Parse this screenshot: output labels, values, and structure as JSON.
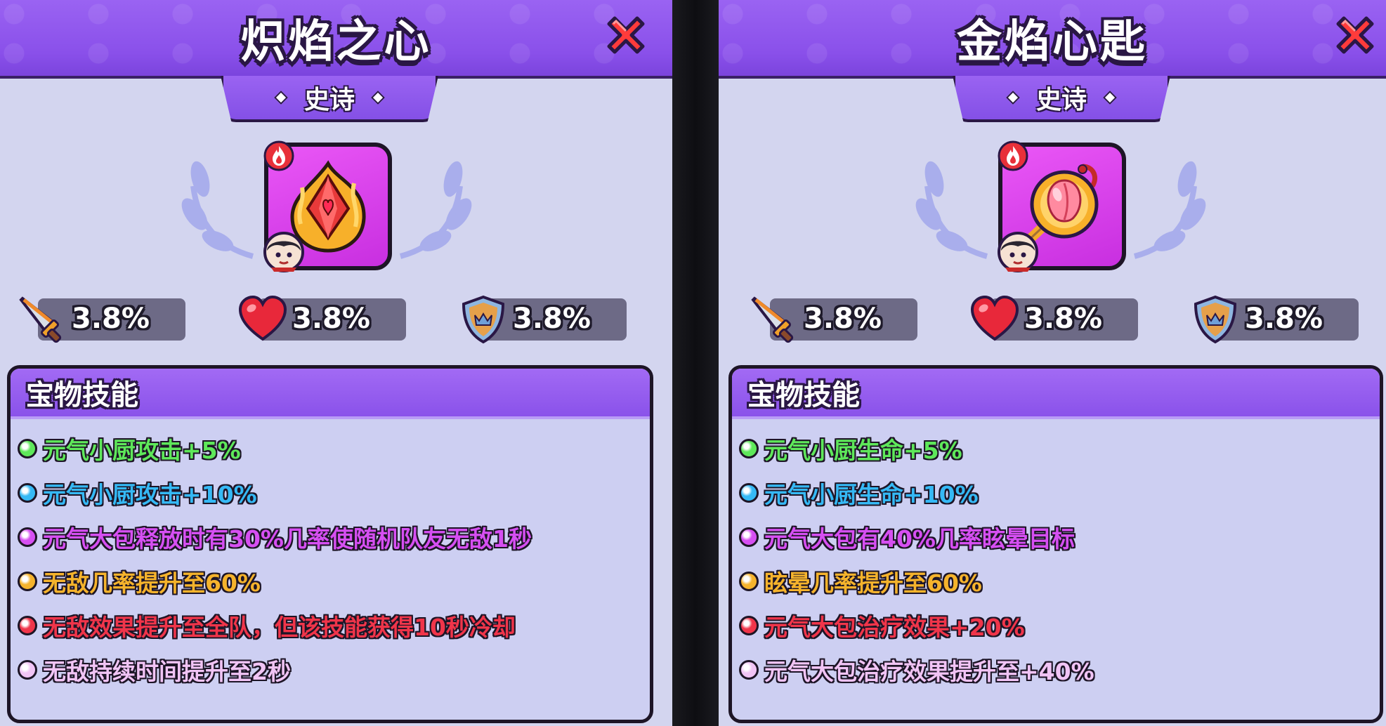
{
  "colors": {
    "tier1_green": "#5ee85a",
    "tier2_blue": "#35b9f5",
    "tier3_purple": "#d64ff2",
    "tier4_orange": "#f5b32c",
    "tier5_red": "#f0354a",
    "tier6_lilac": "#f1c4f5"
  },
  "cards": [
    {
      "title": "炽焰之心",
      "rarity": "史诗",
      "icons": {
        "badge": "fire-icon",
        "item": "flame-heart-gem-icon",
        "avatar": "chef-avatar-icon"
      },
      "stats": [
        {
          "icon": "sword-icon",
          "value": "3.8%"
        },
        {
          "icon": "heart-icon",
          "value": "3.8%"
        },
        {
          "icon": "shield-icon",
          "value": "3.8%"
        }
      ],
      "skills_title": "宝物技能",
      "skills": [
        {
          "tier": "tier1_green",
          "text": "元气小厨攻击+5%"
        },
        {
          "tier": "tier2_blue",
          "text": "元气小厨攻击+10%"
        },
        {
          "tier": "tier3_purple",
          "text": "元气大包释放时有30%几率使随机队友无敌1秒"
        },
        {
          "tier": "tier4_orange",
          "text": "无敌几率提升至60%"
        },
        {
          "tier": "tier5_red",
          "text": "无敌效果提升至全队，但该技能获得10秒冷却"
        },
        {
          "tier": "tier6_lilac",
          "text": "无敌持续时间提升至2秒"
        }
      ]
    },
    {
      "title": "金焰心匙",
      "rarity": "史诗",
      "icons": {
        "badge": "fire-icon",
        "item": "peach-key-pendant-icon",
        "avatar": "chef-avatar-icon"
      },
      "stats": [
        {
          "icon": "sword-icon",
          "value": "3.8%"
        },
        {
          "icon": "heart-icon",
          "value": "3.8%"
        },
        {
          "icon": "shield-icon",
          "value": "3.8%"
        }
      ],
      "skills_title": "宝物技能",
      "skills": [
        {
          "tier": "tier1_green",
          "text": "元气小厨生命+5%"
        },
        {
          "tier": "tier2_blue",
          "text": "元气小厨生命+10%"
        },
        {
          "tier": "tier3_purple",
          "text": "元气大包有40%几率眩晕目标"
        },
        {
          "tier": "tier4_orange",
          "text": "眩晕几率提升至60%"
        },
        {
          "tier": "tier5_red",
          "text": "元气大包治疗效果+20%"
        },
        {
          "tier": "tier6_lilac",
          "text": "元气大包治疗效果提升至+40%"
        }
      ]
    }
  ]
}
